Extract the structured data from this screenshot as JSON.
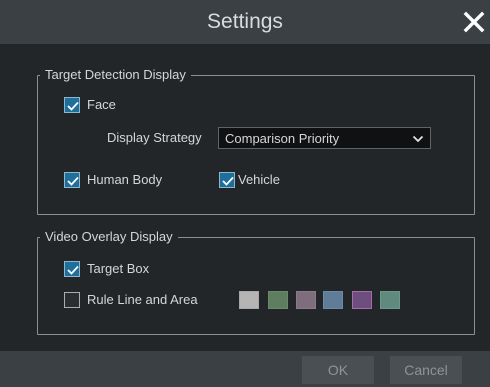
{
  "dialog": {
    "title": "Settings",
    "close_icon": "close-x-icon"
  },
  "target_detection": {
    "legend": "Target Detection Display",
    "face": {
      "label": "Face",
      "checked": true
    },
    "display_strategy": {
      "label": "Display Strategy",
      "value": "Comparison Priority",
      "icon": "chevron-down-icon"
    },
    "human_body": {
      "label": "Human Body",
      "checked": true
    },
    "vehicle": {
      "label": "Vehicle",
      "checked": true
    }
  },
  "video_overlay": {
    "legend": "Video Overlay Display",
    "target_box": {
      "label": "Target Box",
      "checked": true
    },
    "rule_line": {
      "label": "Rule Line and Area",
      "checked": false
    },
    "swatch_colors": [
      "#a8a8a8",
      "#6a8a6a",
      "#8a7a8a",
      "#6a8aa8",
      "#a86aa8",
      "#6a9a8a"
    ],
    "swatch_fills": [
      "#b5b5b5",
      "#5f7d5f",
      "#7d6d7d",
      "#5f7d96",
      "#6d4f7f",
      "#5f8a7d"
    ]
  },
  "footer": {
    "ok_label": "OK",
    "cancel_label": "Cancel"
  }
}
